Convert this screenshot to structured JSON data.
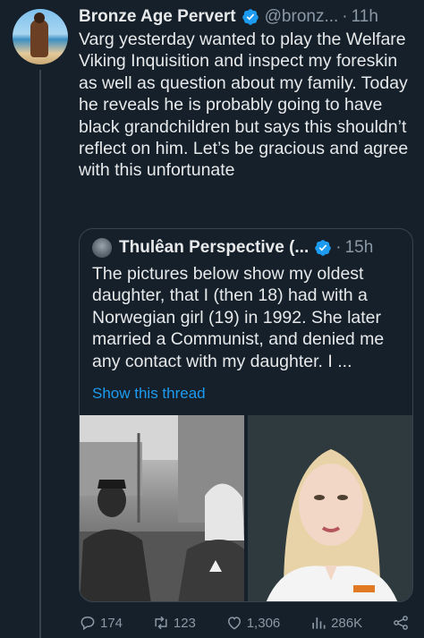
{
  "tweet": {
    "author_name": "Bronze Age Pervert",
    "handle": "@bronz...",
    "separator": "·",
    "time": "11h",
    "text": "Varg yesterday wanted to play the Welfare Viking Inquisition and inspect my foreskin as well as question about my family. Today he reveals he is probably going to have black grandchildren but says this shouldn’t reflect on him. Let’s be gracious and agree with this unfortunate"
  },
  "quote": {
    "author_name": "Thulêan Perspective (...",
    "separator": "·",
    "time": "15h",
    "text": "The pictures below show my oldest daughter, that I (then 18) had with a Norwegian girl (19) in 1992. She later married a Communist, and denied me any contact with my daughter. I ...",
    "show_thread": "Show this thread"
  },
  "actions": {
    "replies": "174",
    "retweets": "123",
    "likes": "1,306",
    "views": "286K"
  },
  "colors": {
    "background": "#15202b",
    "text": "#e7e9ea",
    "muted": "#8b98a5",
    "accent": "#1d9bf0",
    "border": "#38444d"
  }
}
